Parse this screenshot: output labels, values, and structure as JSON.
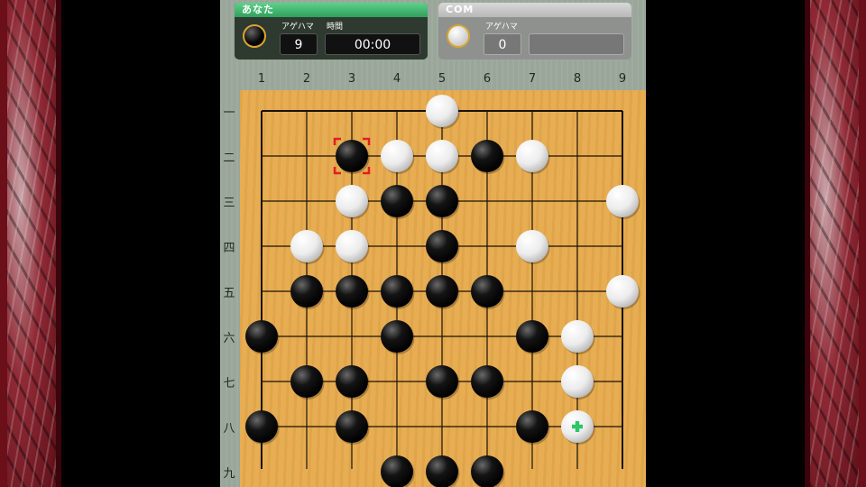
{
  "player": {
    "name": "あなた",
    "captures_label": "アゲハマ",
    "captures": "9",
    "time_label": "時間",
    "time": "00:00",
    "stone": "black-stone-icon"
  },
  "opponent": {
    "name": "COM",
    "captures_label": "アゲハマ",
    "captures": "0",
    "stone": "white-stone-icon"
  },
  "board": {
    "size": 9,
    "col_labels": [
      "1",
      "2",
      "3",
      "4",
      "5",
      "6",
      "7",
      "8",
      "9"
    ],
    "row_labels": [
      "一",
      "二",
      "三",
      "四",
      "五",
      "六",
      "七",
      "八",
      "九"
    ],
    "stones": [
      {
        "col": 5,
        "row": 1,
        "color": "white"
      },
      {
        "col": 3,
        "row": 2,
        "color": "black"
      },
      {
        "col": 4,
        "row": 2,
        "color": "white"
      },
      {
        "col": 5,
        "row": 2,
        "color": "white"
      },
      {
        "col": 6,
        "row": 2,
        "color": "black"
      },
      {
        "col": 7,
        "row": 2,
        "color": "white"
      },
      {
        "col": 3,
        "row": 3,
        "color": "white"
      },
      {
        "col": 4,
        "row": 3,
        "color": "black"
      },
      {
        "col": 5,
        "row": 3,
        "color": "black"
      },
      {
        "col": 9,
        "row": 3,
        "color": "white"
      },
      {
        "col": 2,
        "row": 4,
        "color": "white"
      },
      {
        "col": 3,
        "row": 4,
        "color": "white"
      },
      {
        "col": 5,
        "row": 4,
        "color": "black"
      },
      {
        "col": 7,
        "row": 4,
        "color": "white"
      },
      {
        "col": 2,
        "row": 5,
        "color": "black"
      },
      {
        "col": 3,
        "row": 5,
        "color": "black"
      },
      {
        "col": 4,
        "row": 5,
        "color": "black"
      },
      {
        "col": 5,
        "row": 5,
        "color": "black"
      },
      {
        "col": 6,
        "row": 5,
        "color": "black"
      },
      {
        "col": 9,
        "row": 5,
        "color": "white"
      },
      {
        "col": 1,
        "row": 6,
        "color": "black"
      },
      {
        "col": 4,
        "row": 6,
        "color": "black"
      },
      {
        "col": 7,
        "row": 6,
        "color": "black"
      },
      {
        "col": 8,
        "row": 6,
        "color": "white"
      },
      {
        "col": 2,
        "row": 7,
        "color": "black"
      },
      {
        "col": 3,
        "row": 7,
        "color": "black"
      },
      {
        "col": 5,
        "row": 7,
        "color": "black"
      },
      {
        "col": 6,
        "row": 7,
        "color": "black"
      },
      {
        "col": 8,
        "row": 7,
        "color": "white"
      },
      {
        "col": 1,
        "row": 8,
        "color": "black"
      },
      {
        "col": 3,
        "row": 8,
        "color": "black"
      },
      {
        "col": 7,
        "row": 8,
        "color": "black"
      },
      {
        "col": 8,
        "row": 8,
        "color": "white"
      },
      {
        "col": 4,
        "row": 9,
        "color": "black"
      },
      {
        "col": 5,
        "row": 9,
        "color": "black"
      },
      {
        "col": 6,
        "row": 9,
        "color": "black"
      }
    ],
    "last_move": {
      "col": 3,
      "row": 2
    },
    "cursor": {
      "col": 8,
      "row": 8
    },
    "colors": {
      "board": "#e7ad52",
      "highlight": "#e02020",
      "cursor": "#2ec46a"
    }
  }
}
